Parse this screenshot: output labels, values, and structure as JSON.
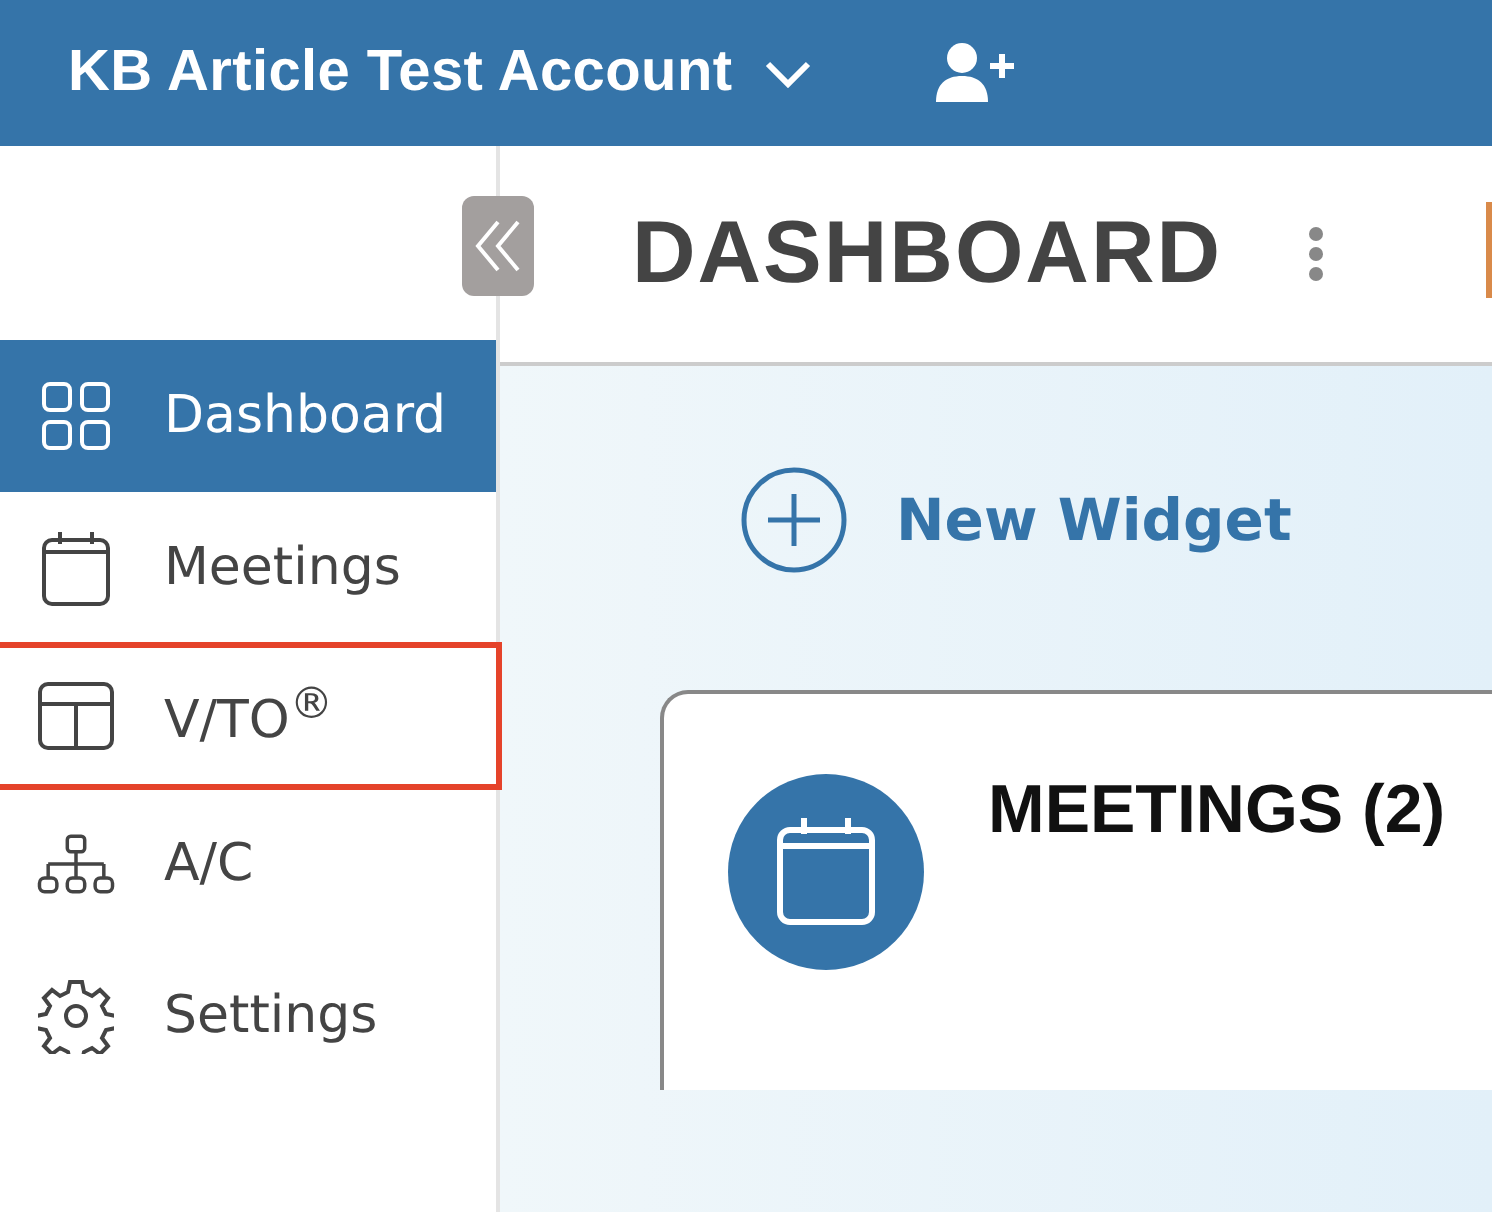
{
  "header": {
    "account": "KB Article Test Account"
  },
  "sidebar": {
    "items": [
      {
        "kind": "dashboard",
        "label": "Dashboard",
        "selected": true,
        "highlighted": false
      },
      {
        "kind": "meetings",
        "label": "Meetings",
        "selected": false,
        "highlighted": false
      },
      {
        "kind": "vto",
        "label": "V/TO$^{®}$",
        "selected": false,
        "highlighted": true
      },
      {
        "kind": "ac",
        "label": "A/C",
        "selected": false,
        "highlighted": false
      },
      {
        "kind": "settings",
        "label": "Settings",
        "selected": false,
        "highlighted": false
      }
    ]
  },
  "main": {
    "title": "DASHBOARD",
    "new_widget": "New Widget",
    "widgets": [
      {
        "title": "MEETINGS (2)"
      }
    ]
  }
}
